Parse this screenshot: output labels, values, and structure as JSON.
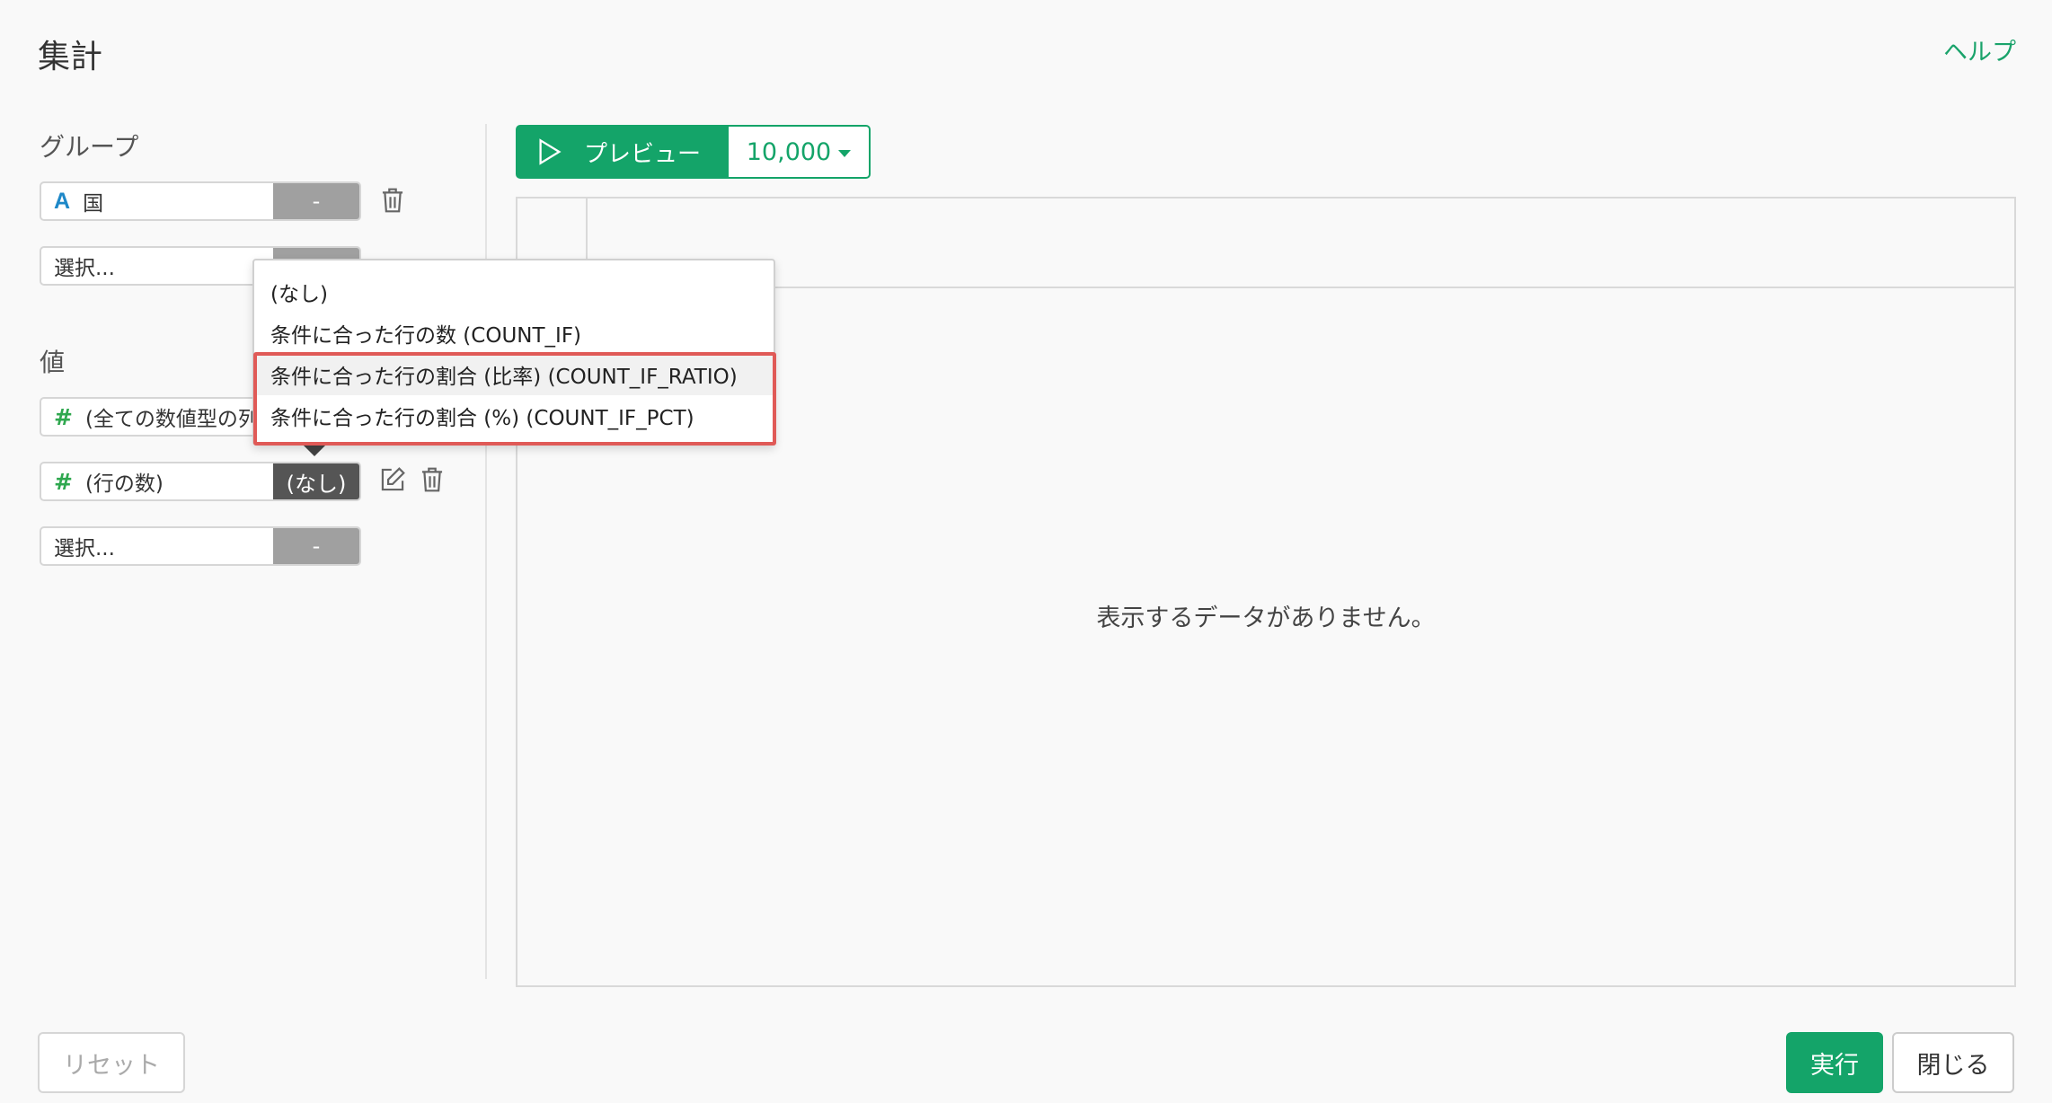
{
  "header": {
    "title": "集計",
    "help_label": "ヘルプ"
  },
  "group": {
    "label": "グループ",
    "fields": [
      {
        "type_icon": "A",
        "name": "国",
        "agg": "-"
      },
      {
        "type_icon": "",
        "name": "選択...",
        "agg": ""
      }
    ]
  },
  "values": {
    "label": "値",
    "fields": [
      {
        "type_icon": "#",
        "name": "(全ての数値型の列)",
        "agg": ""
      },
      {
        "type_icon": "#",
        "name": "(行の数)",
        "agg": "(なし)"
      },
      {
        "type_icon": "",
        "name": "選択...",
        "agg": "-"
      }
    ]
  },
  "dropdown": {
    "options": [
      "(なし)",
      "条件に合った行の数 (COUNT_IF)",
      "条件に合った行の割合 (比率) (COUNT_IF_RATIO)",
      "条件に合った行の割合 (%) (COUNT_IF_PCT)"
    ],
    "hovered_index": 2
  },
  "preview": {
    "button_label": "プレビュー",
    "rows_value": "10,000",
    "empty_message": "表示するデータがありません。"
  },
  "footer": {
    "reset_label": "リセット",
    "run_label": "実行",
    "close_label": "閉じる"
  },
  "colors": {
    "accent": "#14a469",
    "highlight": "#e05a57"
  },
  "icons": [
    "play-icon",
    "trash-icon",
    "edit-icon",
    "caret-down-icon"
  ]
}
